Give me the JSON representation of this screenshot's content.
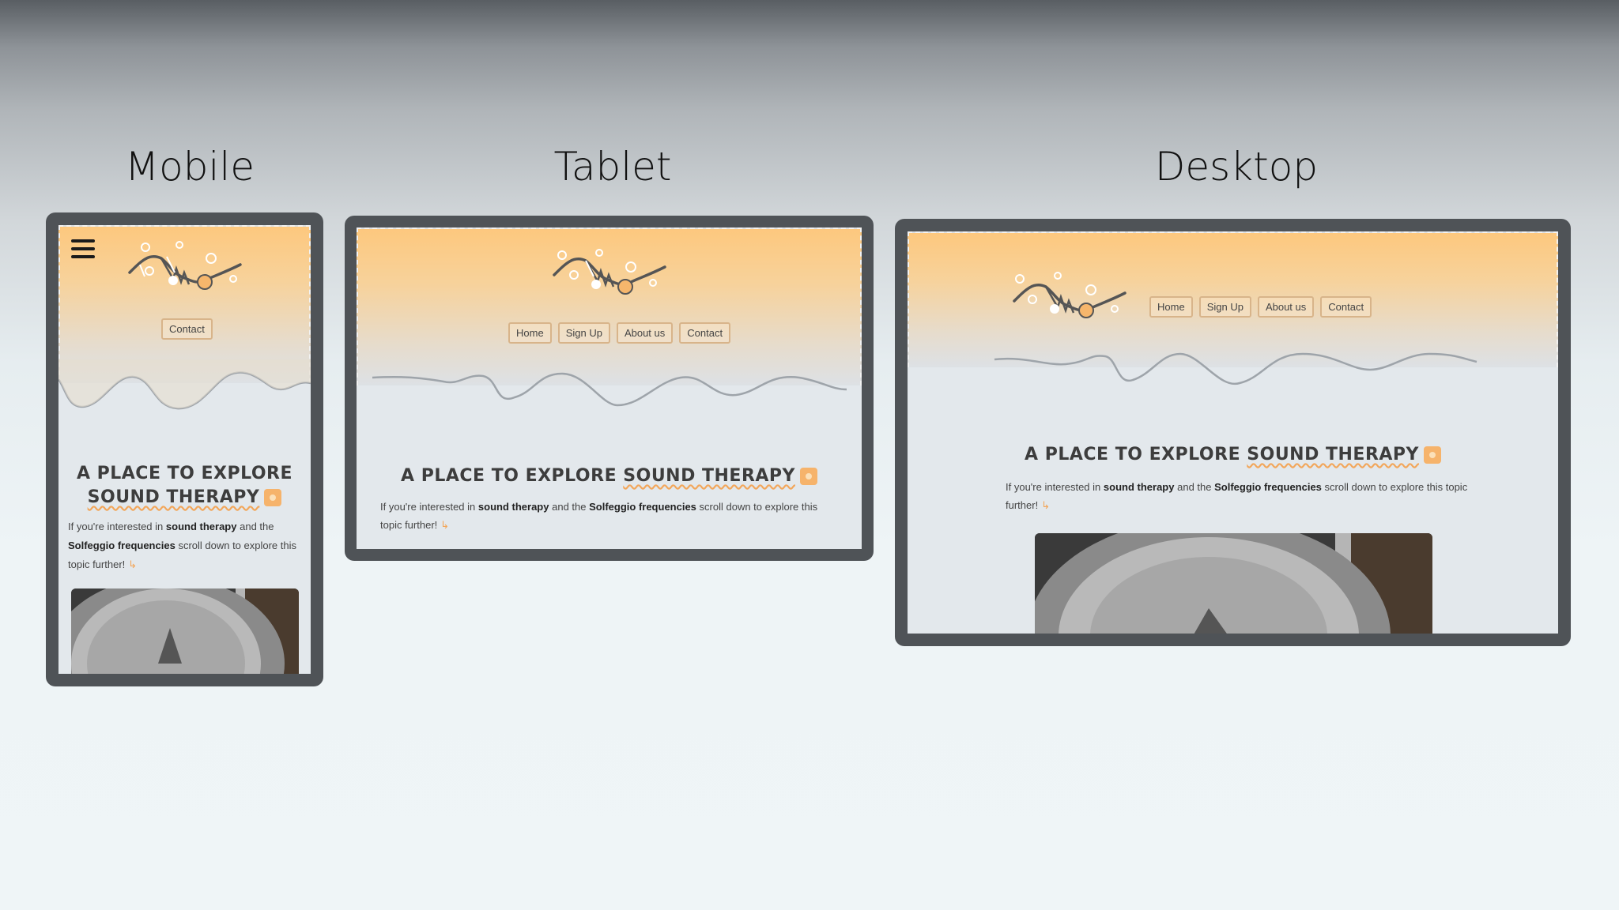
{
  "labels": {
    "mobile": "Mobile",
    "tablet": "Tablet",
    "desktop": "Desktop"
  },
  "site": {
    "nav": {
      "home": "Home",
      "signup": "Sign Up",
      "about": "About us",
      "contact": "Contact"
    },
    "headline_part1": "A place to explore",
    "headline_accent": "sound therapy",
    "intro_prefix": "If you're interested in",
    "intro_b1": "sound therapy",
    "intro_mid": "and the",
    "intro_b2": "Solfeggio frequencies",
    "intro_suffix": "scroll down to explore this topic further!"
  },
  "icons": {
    "menu": "hamburger-menu-icon",
    "logo": "sound-wave-logo",
    "heading_icon": "house-icon",
    "scroll": "scroll-icon"
  },
  "colors": {
    "hero_top": "#fdc87e",
    "accent": "#f2a65a",
    "frame": "#4f5357",
    "screen_bg": "#e3e8ec"
  }
}
